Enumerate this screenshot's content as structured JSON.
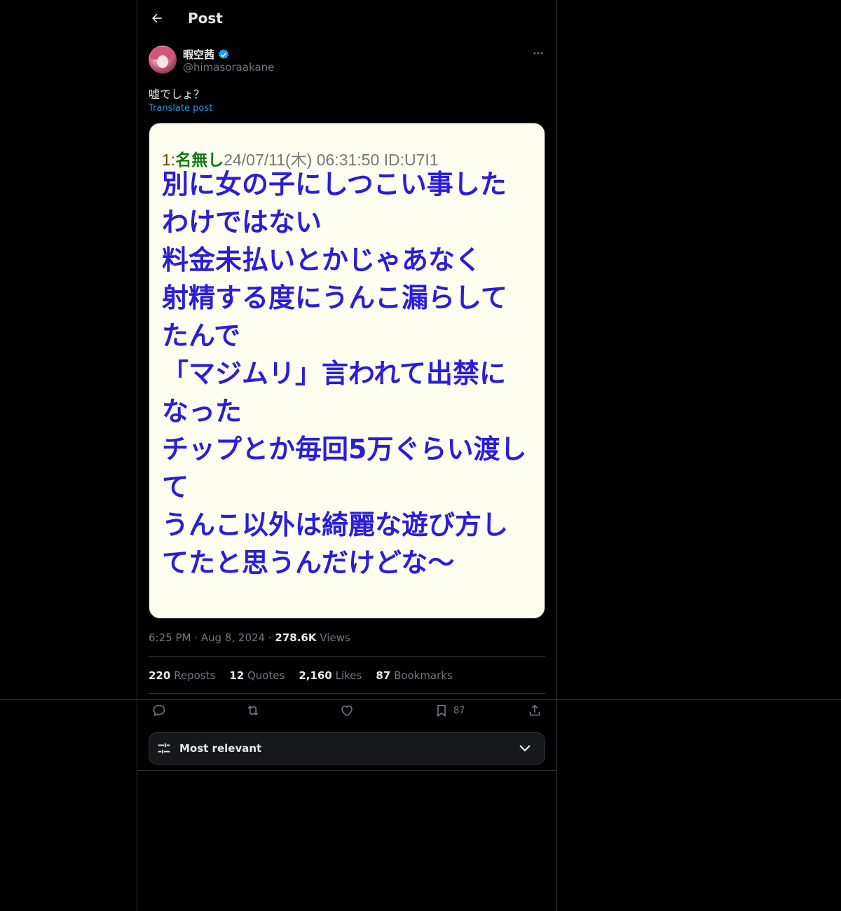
{
  "header": {
    "title": "Post"
  },
  "author": {
    "name": "暇空茜",
    "handle": "@himasoraakane"
  },
  "post": {
    "text": "嘘でしょ？",
    "translate_label": "Translate post"
  },
  "image": {
    "header_num": "1:",
    "header_name": "名無し",
    "header_rest": "24/07/11(木) 06:31:50 ID:U7I1",
    "lines": [
      "別に女の子にしつこい事した",
      "わけではない",
      "料金未払いとかじゃあなく",
      "射精する度にうんこ漏らして",
      "たんで",
      "「マジムリ」言われて出禁に",
      "なった",
      "チップとか毎回5万ぐらい渡し",
      "て",
      "うんこ以外は綺麗な遊び方し",
      "てたと思うんだけどな〜"
    ]
  },
  "meta": {
    "time": "6:25 PM",
    "date": "Aug 8, 2024",
    "views_count": "278.6K",
    "views_label": "Views"
  },
  "stats": {
    "reposts_count": "220",
    "reposts_label": "Reposts",
    "quotes_count": "12",
    "quotes_label": "Quotes",
    "likes_count": "2,160",
    "likes_label": "Likes",
    "bookmarks_count": "87",
    "bookmarks_label": "Bookmarks"
  },
  "actions": {
    "bookmark_count": "87"
  },
  "sort": {
    "label": "Most relevant"
  },
  "colors": {
    "accent": "#1d9bf0",
    "bbs_text": "#2a1ed6",
    "bbs_bg": "#fdfdf0"
  }
}
